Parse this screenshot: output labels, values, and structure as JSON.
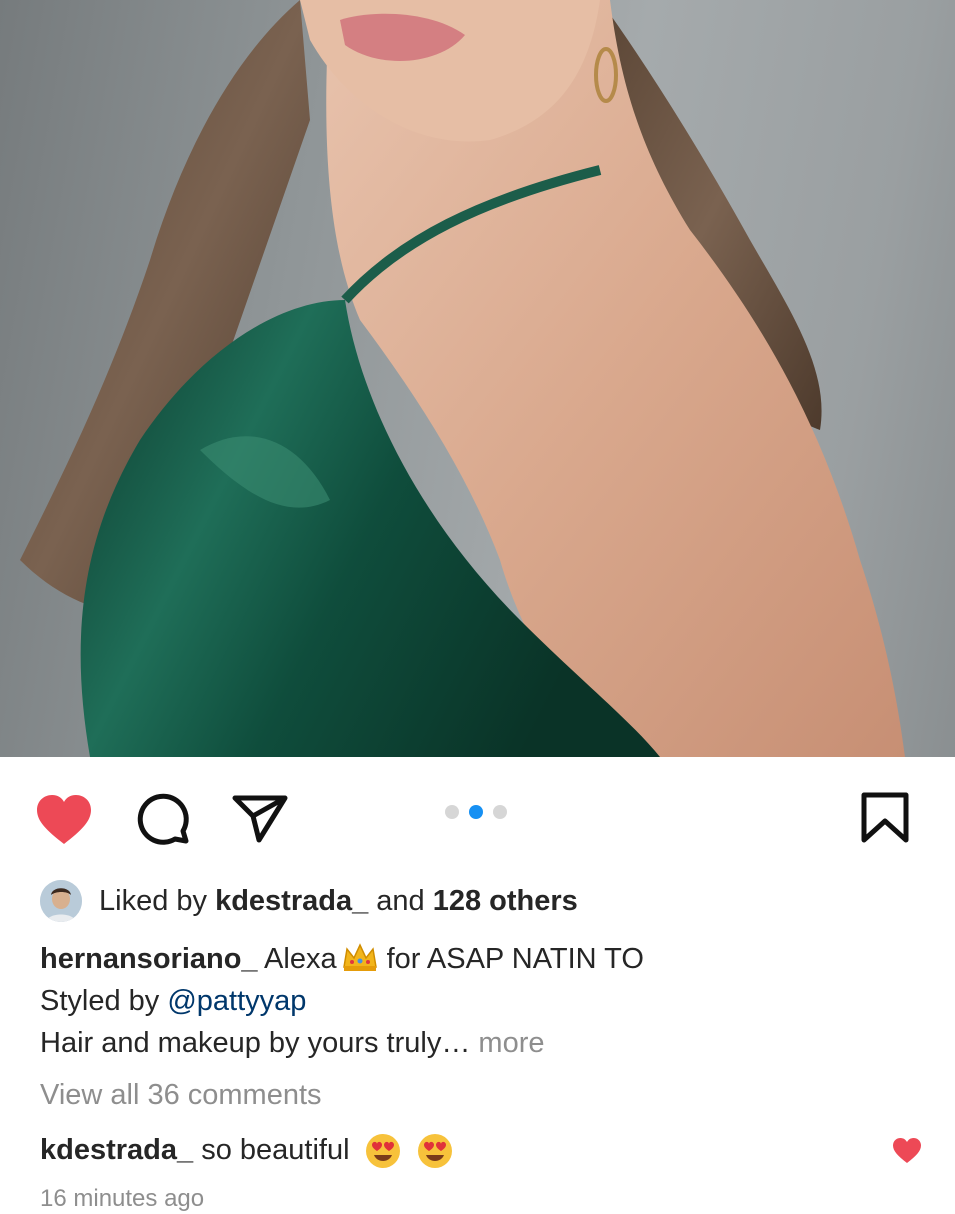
{
  "post": {
    "carousel": {
      "count": 3,
      "active_index": 1
    },
    "liked": true,
    "likes": {
      "prefix": "Liked by ",
      "user": "kdestrada_",
      "middle": " and ",
      "count_text": "128 others"
    },
    "caption": {
      "username": "hernansoriano_",
      "line1_a": "Alexa",
      "line1_b": "for ASAP NATIN TO",
      "line2_prefix": "Styled by ",
      "line2_mention": "@pattyyap",
      "line3": "Hair and makeup by yours truly…",
      "more_label": "more"
    },
    "view_all_comments": "View all 36 comments",
    "top_comment": {
      "username": "kdestrada_",
      "text": "so beautiful"
    },
    "timestamp": "16 minutes ago"
  },
  "colors": {
    "like_red": "#ed4956",
    "dot_active": "#1690f3",
    "mention_blue": "#00376b",
    "muted_gray": "#8e8e8e"
  },
  "icons": {
    "like": "heart-filled-icon",
    "comment": "speech-bubble-icon",
    "share": "paper-plane-icon",
    "save": "bookmark-icon",
    "caption_emoji": "crown-icon",
    "comment_emoji": "heart-eyes-emoji-icon"
  }
}
